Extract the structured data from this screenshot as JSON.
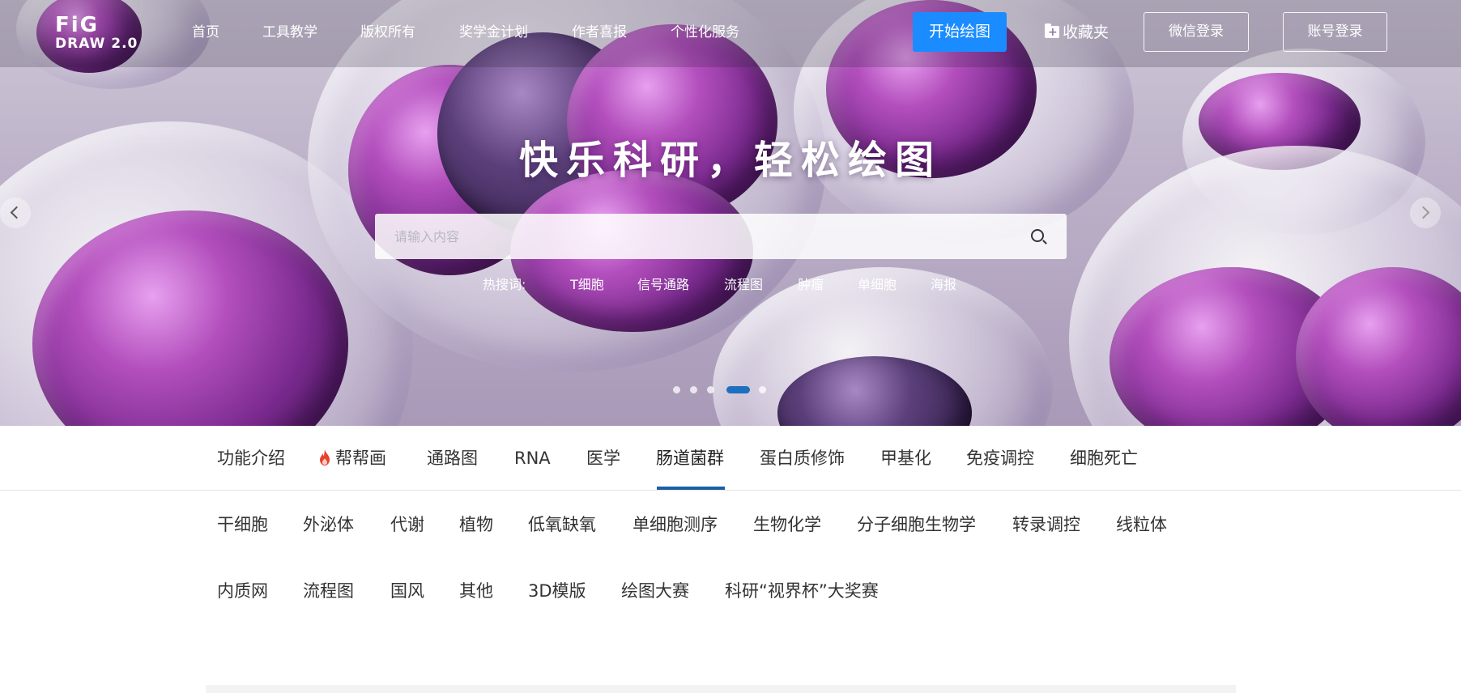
{
  "logo": {
    "line1": "FiG",
    "line2": "DRAW 2.0"
  },
  "nav": {
    "items": [
      "首页",
      "工具教学",
      "版权所有",
      "奖学金计划",
      "作者喜报",
      "个性化服务"
    ],
    "start_label": "开始绘图",
    "favorites_label": "收藏夹",
    "wechat_login": "微信登录",
    "account_login": "账号登录"
  },
  "hero": {
    "slogan": "快乐科研，轻松绘图",
    "search_placeholder": "请输入内容",
    "hot_label": "热搜词:",
    "hot_terms": [
      "T细胞",
      "信号通路",
      "流程图",
      "肿瘤",
      "单细胞",
      "海报"
    ],
    "carousel_count": 5,
    "carousel_active_index": 3
  },
  "categories": {
    "tabs": [
      "功能介绍",
      "帮帮画",
      "通路图",
      "RNA",
      "医学",
      "肠道菌群",
      "蛋白质修饰",
      "甲基化",
      "免疫调控",
      "细胞死亡"
    ],
    "active_tab": "肠道菌群",
    "row1": [
      "干细胞",
      "外泌体",
      "代谢",
      "植物",
      "低氧缺氧",
      "单细胞测序",
      "生物化学",
      "分子细胞生物学",
      "转录调控",
      "线粒体"
    ],
    "row2": [
      "内质网",
      "流程图",
      "国风",
      "其他",
      "3D模版",
      "绘图大赛",
      "科研“视界杯”大奖赛"
    ]
  },
  "icons": {
    "hot_tab": "flame-icon",
    "favorites": "folder-plus-icon",
    "search": "search-icon"
  },
  "colors": {
    "primary": "#1a8cff",
    "active_underline": "#1a5fa3",
    "flame": "#e8412c"
  }
}
